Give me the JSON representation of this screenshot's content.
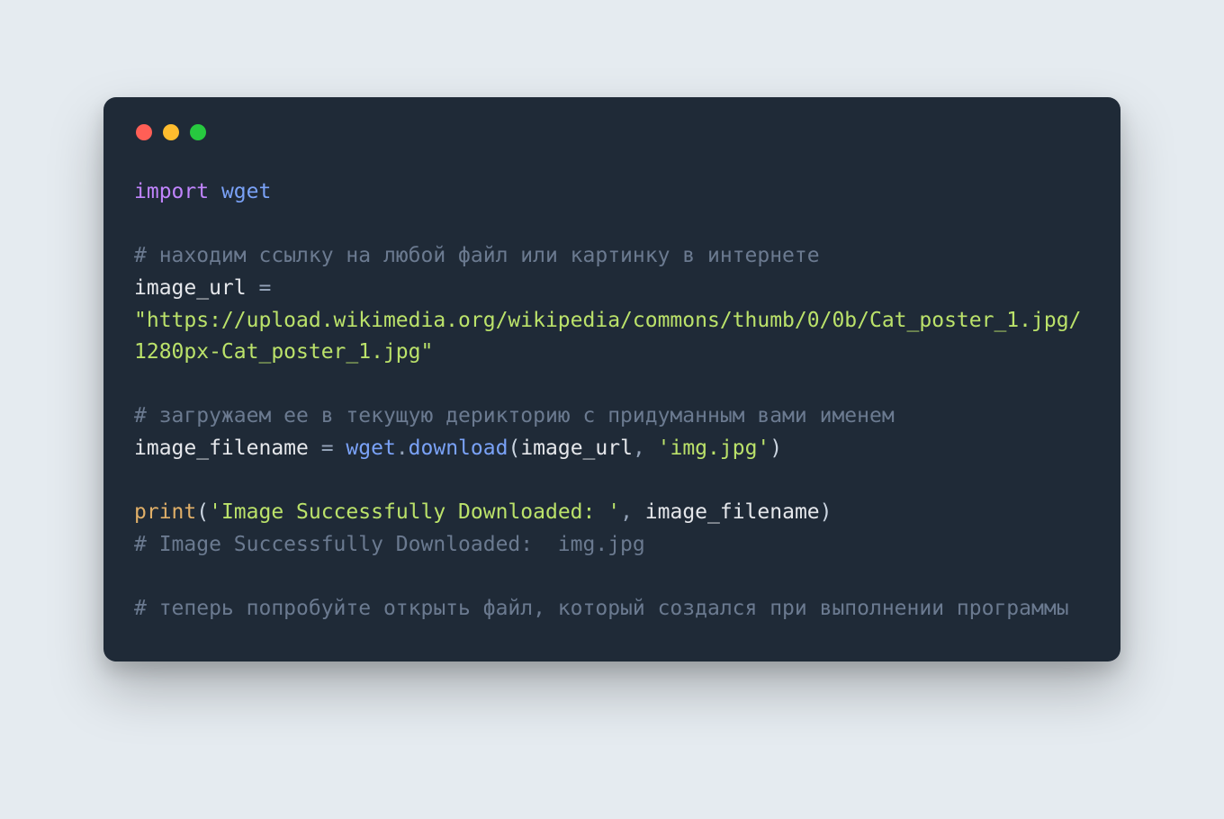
{
  "traffic_lights": {
    "red": "#ff5f56",
    "yellow": "#ffbd2e",
    "green": "#27c93f"
  },
  "code": {
    "kw_import": "import",
    "mod_wget": "wget",
    "comment_1": "# находим ссылку на любой файл или картинку в интернете",
    "var_image_url": "image_url",
    "op_eq1": " =",
    "str_url": "\"https://upload.wikimedia.org/wikipedia/commons/thumb/0/0b/Cat_poster_1.jpg/1280px-Cat_poster_1.jpg\"",
    "comment_2": "# загружаем ее в текущую дерикторию с придуманным вами именем",
    "var_image_filename": "image_filename",
    "op_eq2": " = ",
    "mod_wget2": "wget",
    "dot": ".",
    "fn_download": "download",
    "paren_open1": "(",
    "arg1": "image_url",
    "comma1": ", ",
    "str_img": "'img.jpg'",
    "paren_close1": ")",
    "fn_print": "print",
    "paren_open2": "(",
    "str_msg": "'Image Successfully Downloaded: '",
    "comma2": ", ",
    "arg2": "image_filename",
    "paren_close2": ")",
    "comment_3": "# Image Successfully Downloaded:  img.jpg",
    "comment_4": "# теперь попробуйте открыть файл, который создался при выполнении программы"
  }
}
